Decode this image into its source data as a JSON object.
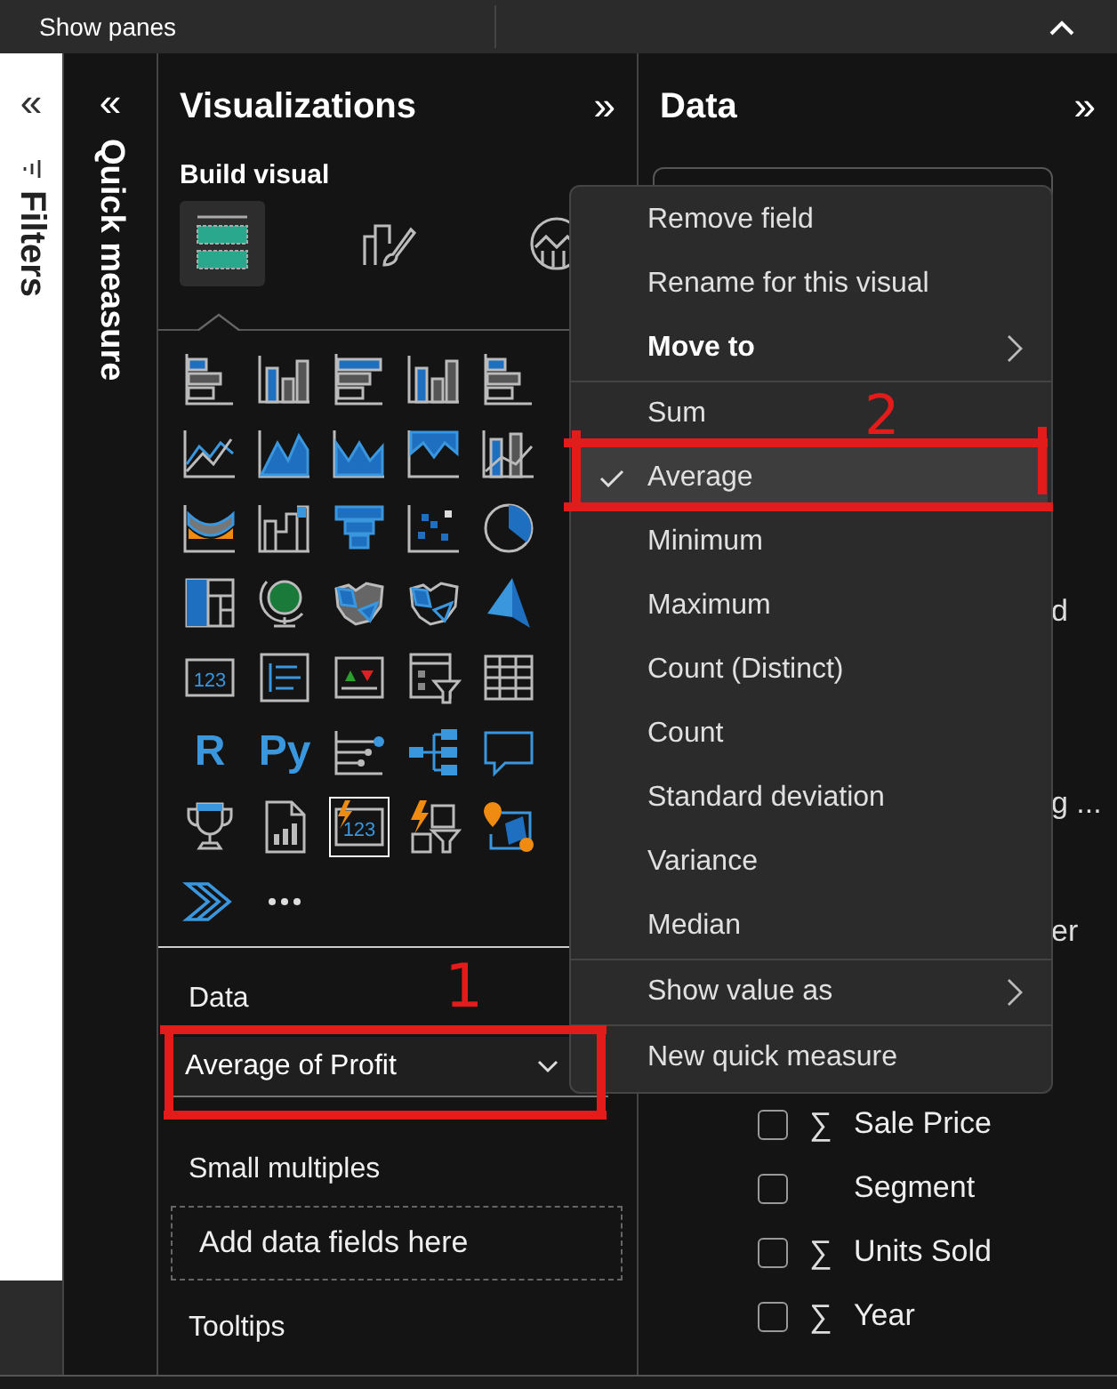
{
  "top_bar": {
    "label": "Show panes"
  },
  "filters_pane": {
    "collapse": "«",
    "title": "Filters"
  },
  "quick_measure_pane": {
    "collapse": "«",
    "title": "Quick measure"
  },
  "visualizations": {
    "title": "Visualizations",
    "expand": "»",
    "subtitle": "Build visual",
    "build_tabs": [
      {
        "kind": "fields",
        "selected": true
      },
      {
        "kind": "format",
        "selected": false
      },
      {
        "kind": "analytics",
        "selected": false
      }
    ],
    "visuals": [
      {
        "kind": "stacked-bar",
        "selected": false
      },
      {
        "kind": "stacked-column",
        "selected": false
      },
      {
        "kind": "clustered-bar",
        "selected": false
      },
      {
        "kind": "clustered-column",
        "selected": false
      },
      {
        "kind": "full-bar",
        "selected": false
      },
      {
        "kind": "line",
        "selected": false
      },
      {
        "kind": "area",
        "selected": false
      },
      {
        "kind": "stacked-area",
        "selected": false
      },
      {
        "kind": "full-area",
        "selected": false
      },
      {
        "kind": "line-column",
        "selected": false
      },
      {
        "kind": "ribbon",
        "selected": false
      },
      {
        "kind": "waterfall",
        "selected": false
      },
      {
        "kind": "funnel",
        "selected": false
      },
      {
        "kind": "scatter",
        "selected": false
      },
      {
        "kind": "pie",
        "selected": false
      },
      {
        "kind": "treemap",
        "selected": false
      },
      {
        "kind": "globe",
        "selected": false
      },
      {
        "kind": "filled-map",
        "selected": false
      },
      {
        "kind": "shape-map",
        "selected": false
      },
      {
        "kind": "arrow",
        "selected": false
      },
      {
        "kind": "card",
        "text": "123",
        "selected": false
      },
      {
        "kind": "multirow-card",
        "selected": false
      },
      {
        "kind": "kpi",
        "selected": false
      },
      {
        "kind": "slicer",
        "selected": false
      },
      {
        "kind": "table",
        "selected": false
      },
      {
        "kind": "letters",
        "text": "R",
        "selected": false
      },
      {
        "kind": "letters",
        "text": "Py",
        "selected": false
      },
      {
        "kind": "influencers",
        "selected": false
      },
      {
        "kind": "tree",
        "selected": false
      },
      {
        "kind": "bubble",
        "selected": false
      },
      {
        "kind": "trophy",
        "selected": false
      },
      {
        "kind": "report",
        "selected": false
      },
      {
        "kind": "smart-card",
        "text": "123",
        "selected": true
      },
      {
        "kind": "lightning-filter",
        "selected": false
      },
      {
        "kind": "pin-map",
        "selected": false
      },
      {
        "kind": "automate",
        "selected": false
      },
      {
        "kind": "more",
        "selected": false
      }
    ],
    "wells": [
      {
        "title": "Data",
        "fields": [
          {
            "label": "Average of Profit"
          }
        ]
      },
      {
        "title": "Small multiples",
        "placeholder": "Add data fields here"
      },
      {
        "title": "Tooltips"
      }
    ]
  },
  "data_pane": {
    "title": "Data",
    "expand": "»",
    "covered_fields": [
      {
        "text": "d"
      },
      {
        "text": "g ..."
      },
      {
        "text": "er"
      }
    ],
    "fields": [
      {
        "label": "Sale Price",
        "sigma": "∑",
        "checked": false
      },
      {
        "label": "Segment",
        "checked": false
      },
      {
        "label": "Units Sold",
        "sigma": "∑",
        "checked": false
      },
      {
        "label": "Year",
        "sigma": "∑",
        "checked": false
      }
    ]
  },
  "context_menu": [
    {
      "kind": "item",
      "label": "Remove field"
    },
    {
      "kind": "item",
      "label": "Rename for this visual"
    },
    {
      "kind": "submenu",
      "label": "Move to",
      "bold": true
    },
    {
      "kind": "divider"
    },
    {
      "kind": "choice",
      "label": "Sum",
      "selected": false
    },
    {
      "kind": "choice",
      "label": "Average",
      "selected": true
    },
    {
      "kind": "choice",
      "label": "Minimum",
      "selected": false
    },
    {
      "kind": "choice",
      "label": "Maximum",
      "selected": false
    },
    {
      "kind": "choice",
      "label": "Count (Distinct)",
      "selected": false
    },
    {
      "kind": "choice",
      "label": "Count",
      "selected": false
    },
    {
      "kind": "choice",
      "label": "Standard deviation",
      "selected": false
    },
    {
      "kind": "choice",
      "label": "Variance",
      "selected": false
    },
    {
      "kind": "choice",
      "label": "Median",
      "selected": false
    },
    {
      "kind": "divider"
    },
    {
      "kind": "submenu",
      "label": "Show value as"
    },
    {
      "kind": "divider"
    },
    {
      "kind": "item",
      "label": "New quick measure"
    }
  ],
  "annotations": [
    {
      "kind": "box",
      "label": "1"
    },
    {
      "kind": "box",
      "label": "2"
    }
  ]
}
